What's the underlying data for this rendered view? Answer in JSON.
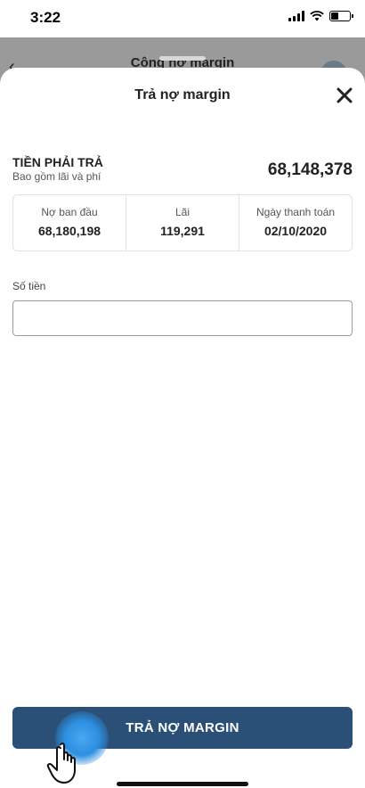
{
  "status_bar": {
    "time": "3:22",
    "battery_level": 0.4
  },
  "background_screen": {
    "title": "Công nợ margin",
    "back_icon": "chevron-left-icon"
  },
  "sheet": {
    "title": "Trả nợ margin",
    "close_icon": "close-icon",
    "amount_due": {
      "label": "TIỀN PHẢI TRẢ",
      "sublabel": "Bao gồm lãi và phí",
      "value": "68,148,378"
    },
    "info": [
      {
        "label": "Nợ ban đầu",
        "value": "68,180,198"
      },
      {
        "label": "Lãi",
        "value": "119,291"
      },
      {
        "label": "Ngày thanh toán",
        "value": "02/10/2020"
      }
    ],
    "amount_field": {
      "label": "Số tiền",
      "value": "",
      "placeholder": ""
    },
    "submit_label": "TRẢ NỢ MARGIN"
  },
  "colors": {
    "primary": "#2a5078",
    "overlay": "#8f8f8f",
    "touch": "#2d8fe0"
  }
}
